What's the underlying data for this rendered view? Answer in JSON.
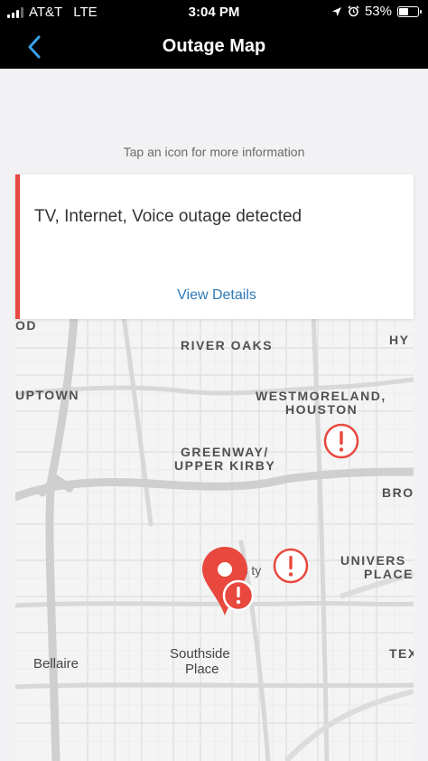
{
  "status_bar": {
    "carrier": "AT&T",
    "network": "LTE",
    "time": "3:04 PM",
    "battery_percent": "53%",
    "battery_level": 0.53
  },
  "nav": {
    "title": "Outage Map",
    "back_icon": "chevron-left-icon"
  },
  "hint": "Tap an icon for more information",
  "alert_card": {
    "title": "TV, Internet, Voice outage detected",
    "link_label": "View Details",
    "accent_color": "#e8483e"
  },
  "map": {
    "labels": {
      "od": "OD",
      "river_oaks": "RIVER OAKS",
      "hy": "HY",
      "uptown": "UPTOWN",
      "westmoreland": "WESTMORELAND,",
      "houston": "HOUSTON",
      "greenway": "GREENWAY/",
      "upper_kirby": "UPPER KIRBY",
      "bro": "BRO",
      "university": "Univers ty",
      "univers_place_1": "UNIVERS",
      "univers_place_2": "PLACE",
      "southside": "Southside",
      "place": "Place",
      "tex": "TEX",
      "bellaire": "Bellaire"
    },
    "marker_color": "#e8483e"
  }
}
